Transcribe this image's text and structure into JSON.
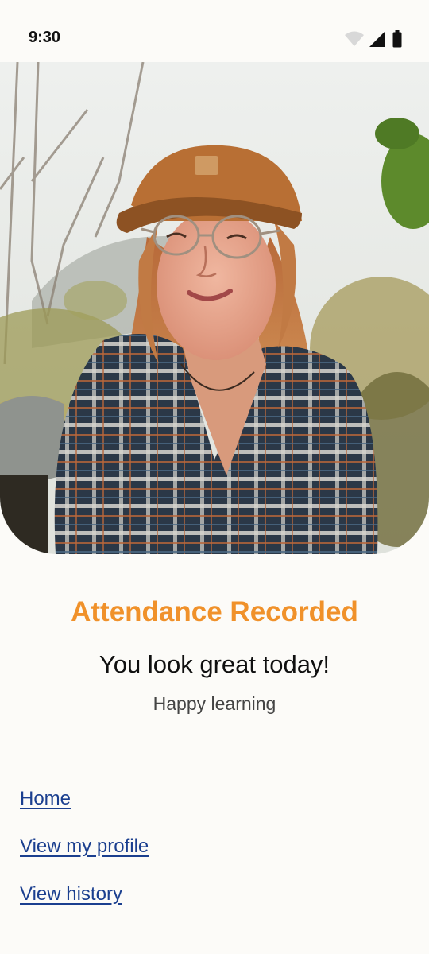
{
  "status_bar": {
    "time": "9:30",
    "icons": [
      "wifi-icon",
      "cellular-signal-icon",
      "battery-icon"
    ]
  },
  "hero": {
    "image": "smiling-woman-photo"
  },
  "message": {
    "title": "Attendance Recorded",
    "subtitle": "You look great today!",
    "caption": "Happy learning"
  },
  "links": {
    "home": "Home",
    "profile": "View my profile",
    "history": "View history"
  },
  "colors": {
    "accent": "#f0912a",
    "link": "#1b3f8f",
    "background": "#fcfbf8"
  }
}
